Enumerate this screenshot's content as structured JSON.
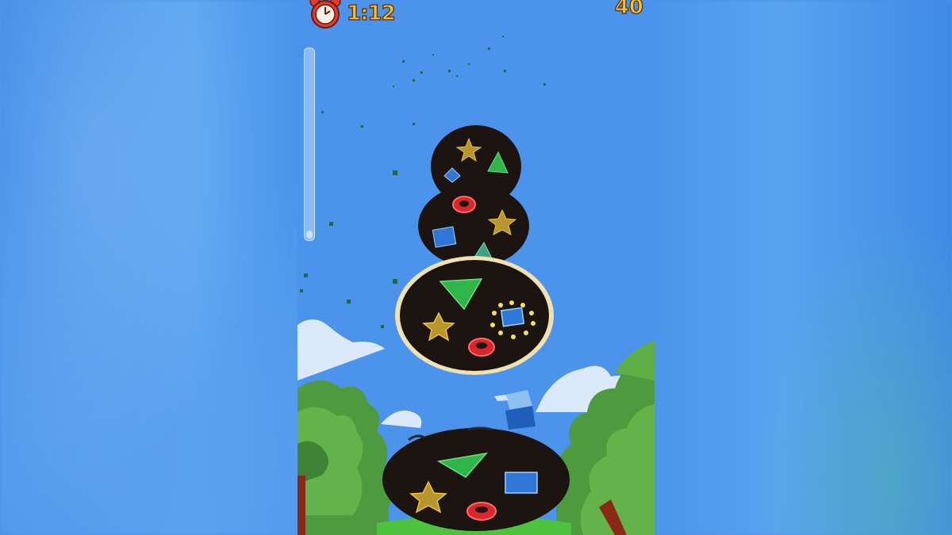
{
  "hud": {
    "timer": "1:12",
    "score": "40",
    "progress_fraction": 0.04
  },
  "icons": {
    "timer": "alarm-clock-icon"
  },
  "colors": {
    "sky": "#4c93ec",
    "hud_text": "#f4c531",
    "hole_fill": "#1b1410",
    "star": "#e8c33a",
    "triangle": "#2fb54a",
    "square": "#2e77d6",
    "ring": "#d9262a"
  }
}
